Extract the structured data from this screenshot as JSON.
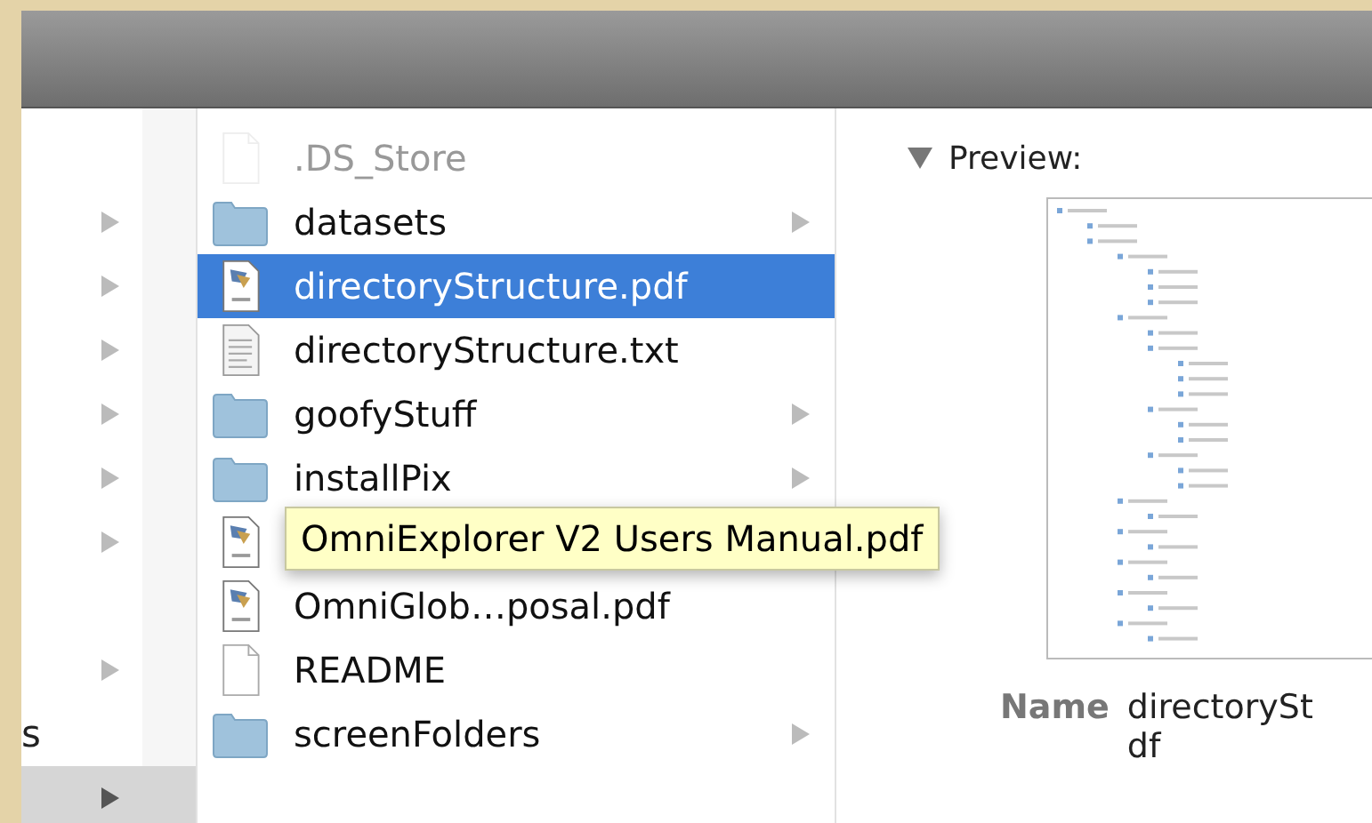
{
  "sidebar_column": {
    "rows": [
      {
        "arrow": false,
        "selected": false
      },
      {
        "arrow": true,
        "selected": false
      },
      {
        "arrow": true,
        "selected": false
      },
      {
        "arrow": true,
        "selected": false
      },
      {
        "arrow": true,
        "selected": false
      },
      {
        "arrow": true,
        "selected": false
      },
      {
        "arrow": true,
        "selected": false
      },
      {
        "arrow": false,
        "selected": false
      },
      {
        "arrow": true,
        "selected": false
      },
      {
        "label": "s",
        "arrow": false,
        "selected": false
      },
      {
        "arrow": true,
        "selected": true
      }
    ]
  },
  "file_column": {
    "rows": [
      {
        "name": ".DS_Store",
        "kind": "file",
        "dimmed": true,
        "arrow": false,
        "selected": false
      },
      {
        "name": "datasets",
        "kind": "folder",
        "dimmed": false,
        "arrow": true,
        "selected": false
      },
      {
        "name": "directoryStructure.pdf",
        "kind": "pdf",
        "dimmed": false,
        "arrow": false,
        "selected": true
      },
      {
        "name": "directoryStructure.txt",
        "kind": "text",
        "dimmed": false,
        "arrow": false,
        "selected": false
      },
      {
        "name": "goofyStuff",
        "kind": "folder",
        "dimmed": false,
        "arrow": true,
        "selected": false
      },
      {
        "name": "installPix",
        "kind": "folder",
        "dimmed": false,
        "arrow": true,
        "selected": false
      },
      {
        "kind": "pdf",
        "dimmed": false,
        "selected": false
      },
      {
        "name": "OmniGlob…posal.pdf",
        "kind": "pdf",
        "dimmed": false,
        "arrow": false,
        "selected": false
      },
      {
        "name": "README",
        "kind": "file",
        "dimmed": false,
        "arrow": false,
        "selected": false
      },
      {
        "name": "screenFolders",
        "kind": "folder",
        "dimmed": false,
        "arrow": true,
        "selected": false
      }
    ]
  },
  "tooltip": {
    "text": "OmniExplorer V2 Users Manual.pdf"
  },
  "preview": {
    "heading": "Preview:",
    "expanded": true,
    "fields": [
      {
        "label": "Name",
        "lines": [
          "directorySt",
          "df"
        ]
      }
    ]
  }
}
